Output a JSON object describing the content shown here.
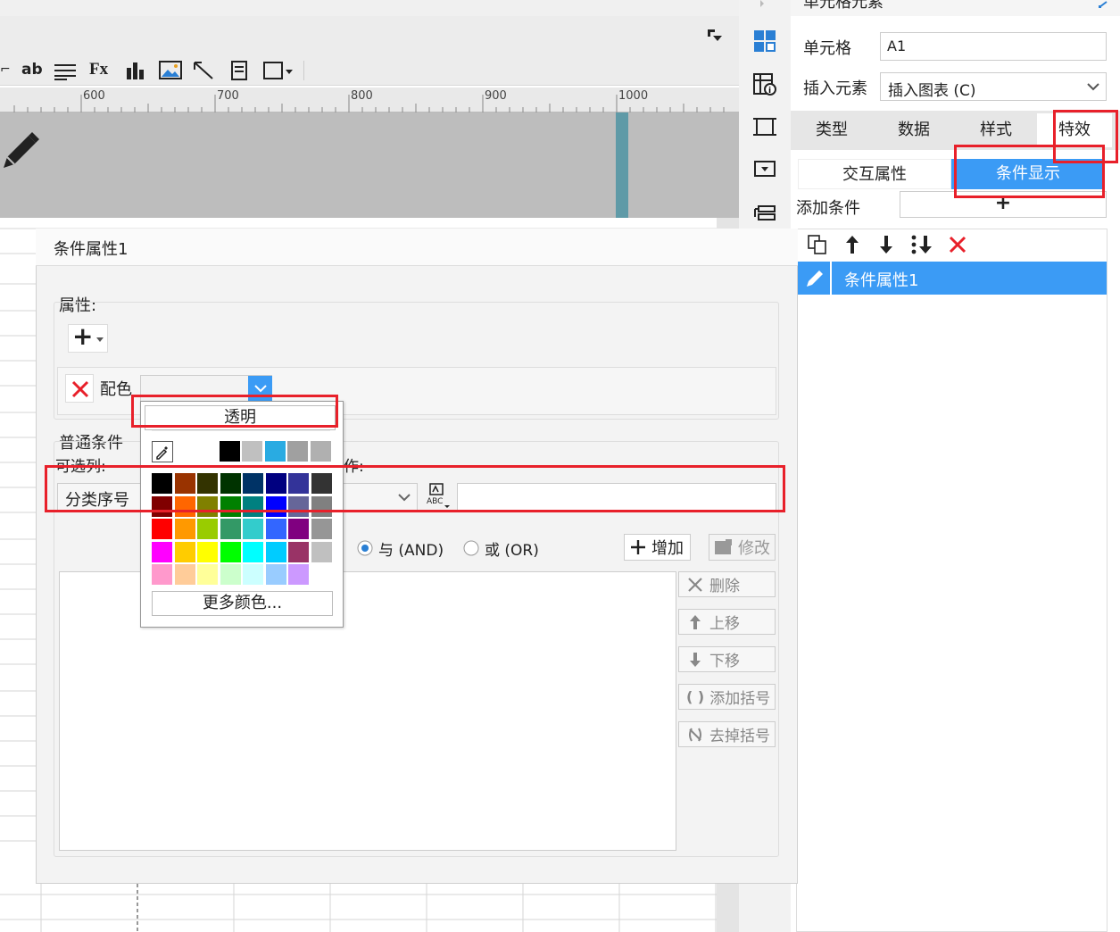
{
  "canvas": {
    "ruler_ticks": [
      "600",
      "700",
      "800",
      "900",
      "1000"
    ],
    "toolbar_text": {
      "ab": "ab",
      "fx": "Fx"
    }
  },
  "right_panel": {
    "title": "单元格元素",
    "cell_label": "单元格",
    "cell_value": "A1",
    "insert_label": "插入元素",
    "insert_value": "插入图表 (C)",
    "tabs": [
      {
        "label": "类型"
      },
      {
        "label": "数据"
      },
      {
        "label": "样式"
      },
      {
        "label": "特效"
      }
    ],
    "subtabs": [
      {
        "label": "交互属性"
      },
      {
        "label": "条件显示"
      }
    ],
    "add_condition_label": "添加条件",
    "add_condition_button": "+",
    "list_item": "条件属性1"
  },
  "dialog": {
    "title": "条件属性1",
    "attributes_label": "属性:",
    "add_button": "+",
    "color_label": "配色",
    "normal_condition_label": "普通条件",
    "optional_column_label": "可选列:",
    "operator_label_suffix": "作:",
    "column_value": "分类序号",
    "and_label": "与 (AND)",
    "or_label": "或 (OR)",
    "add_label": "增加",
    "modify_label": "修改",
    "delete_label": "删除",
    "up_label": "上移",
    "down_label": "下移",
    "add_bracket_label": "添加括号",
    "remove_bracket_label": "去掉括号"
  },
  "color_popup": {
    "transparent_label": "透明",
    "more_colors_label": "更多颜色...",
    "recent_colors": [
      "#ffffff",
      "#000000",
      "#c0c0c0",
      "#29abe2",
      "#a0a0a0",
      "#b0b0b0"
    ],
    "palette_rows": [
      [
        "#000000",
        "#993300",
        "#333300",
        "#003300",
        "#003366",
        "#000080",
        "#333399",
        "#333333"
      ],
      [
        "#800000",
        "#ff6600",
        "#808000",
        "#008000",
        "#008080",
        "#0000ff",
        "#666699",
        "#808080"
      ],
      [
        "#ff0000",
        "#ff9900",
        "#99cc00",
        "#339966",
        "#33cccc",
        "#3366ff",
        "#800080",
        "#969696"
      ],
      [
        "#ff00ff",
        "#ffcc00",
        "#ffff00",
        "#00ff00",
        "#00ffff",
        "#00ccff",
        "#993366",
        "#c0c0c0"
      ],
      [
        "#ff99cc",
        "#ffcc99",
        "#ffff99",
        "#ccffcc",
        "#ccffff",
        "#99ccff",
        "#cc99ff",
        "#ffffff"
      ]
    ]
  },
  "colors": {
    "accent_blue": "#3b9bf5",
    "highlight_red": "#e8202a",
    "delete_red": "#e8202a"
  }
}
